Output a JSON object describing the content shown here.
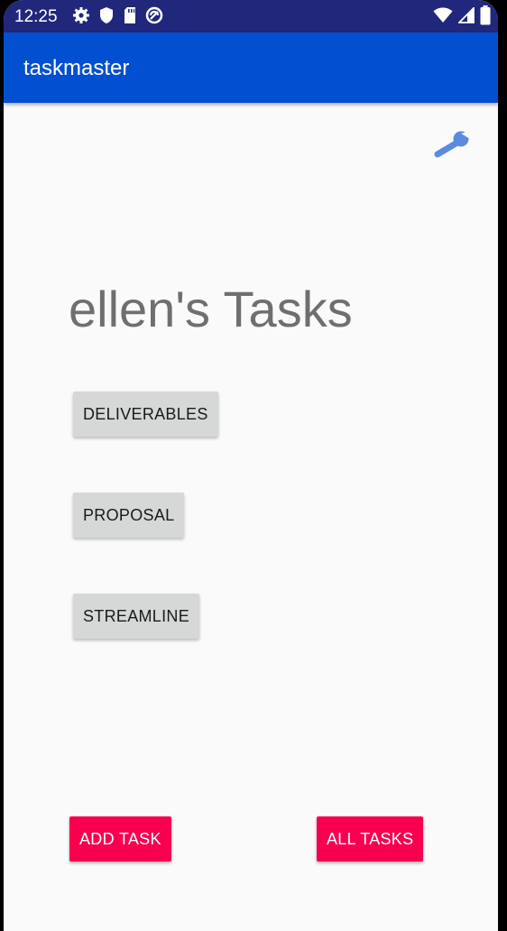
{
  "status_bar": {
    "time": "12:25",
    "left_icons": [
      "gear-icon",
      "shield-icon",
      "sd-card-icon",
      "sync-icon"
    ],
    "right_icons": [
      "wifi-icon",
      "signal-icon",
      "battery-icon"
    ]
  },
  "app_bar": {
    "title": "taskmaster"
  },
  "settings": {
    "icon": "wrench-icon",
    "color": "#5b8bdf"
  },
  "main": {
    "heading": "ellen's Tasks",
    "tasks": [
      {
        "label": "DELIVERABLES"
      },
      {
        "label": "PROPOSAL"
      },
      {
        "label": "STREAMLINE"
      }
    ]
  },
  "actions": {
    "add_task": "ADD TASK",
    "all_tasks": "ALL TASKS"
  },
  "colors": {
    "status_bar": "#21277b",
    "app_bar": "#0250cf",
    "accent": "#f7004f",
    "task_button": "#d6d7d7",
    "heading_text": "#6f6f6f"
  }
}
